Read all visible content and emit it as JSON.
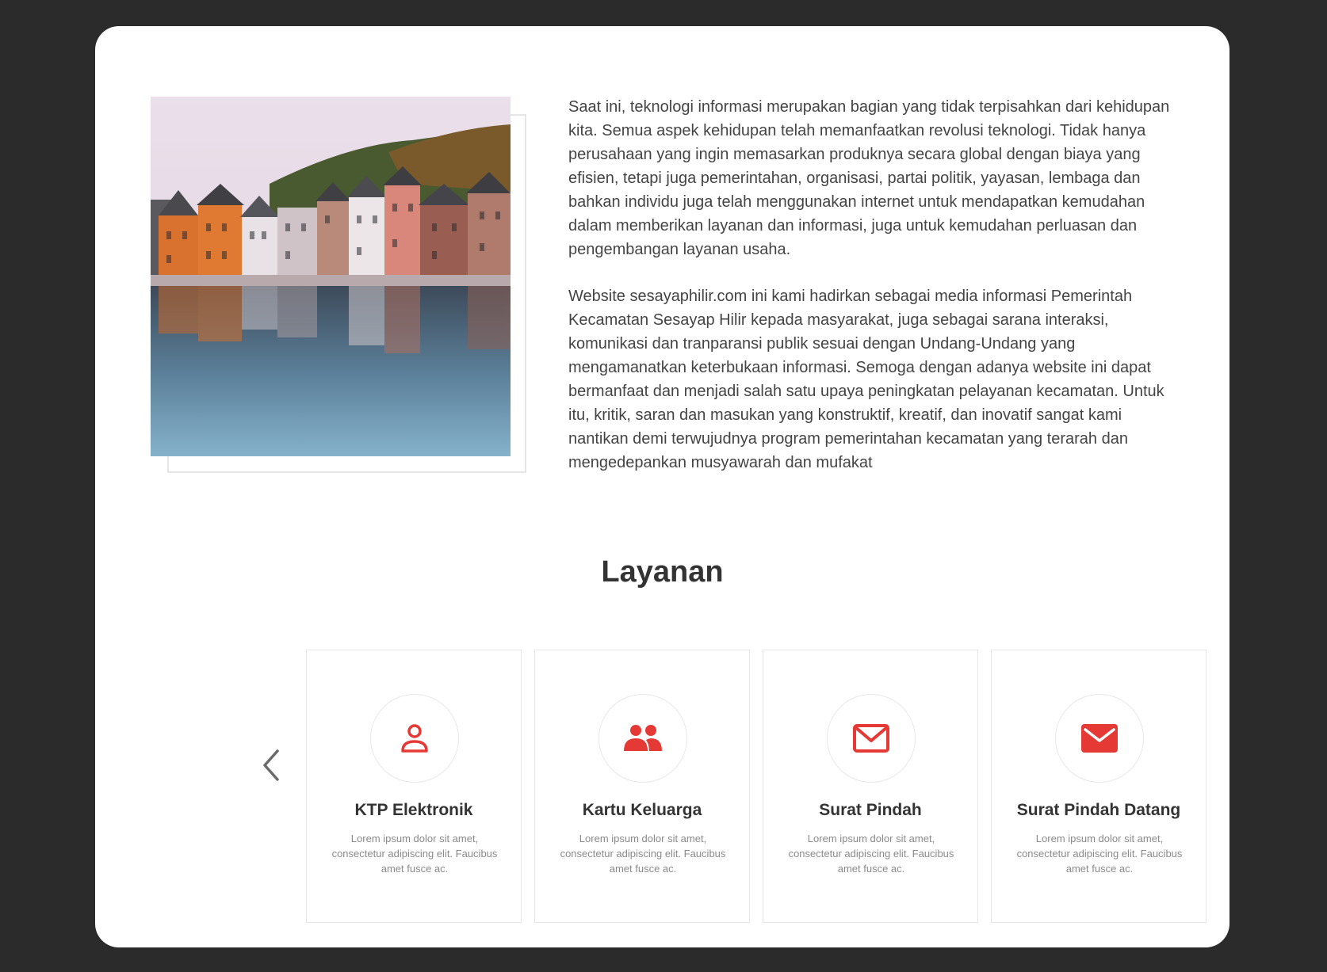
{
  "about": {
    "image_alt": "riverside-town-photo",
    "paragraphs": [
      "Saat ini, teknologi informasi merupakan bagian yang tidak terpisahkan dari kehidupan kita. Semua aspek kehidupan telah memanfaatkan revolusi teknologi. Tidak hanya perusahaan yang ingin memasarkan produknya secara global dengan biaya yang efisien, tetapi juga pemerintahan, organisasi, partai politik, yayasan, lembaga dan bahkan individu juga telah menggunakan internet untuk mendapatkan kemudahan dalam memberikan layanan dan informasi, juga untuk kemudahan perluasan dan pengembangan layanan usaha.",
      "Website sesayaphilir.com ini kami hadirkan sebagai media informasi Pemerintah Kecamatan Sesayap Hilir kepada masyarakat, juga sebagai sarana interaksi, komunikasi dan tranparansi publik sesuai dengan Undang-Undang yang mengamanatkan keterbukaan informasi. Semoga dengan adanya website ini dapat bermanfaat dan menjadi salah satu upaya peningkatan pelayanan kecamatan. Untuk itu, kritik, saran dan masukan yang konstruktif, kreatif, dan inovatif sangat kami nantikan demi terwujudnya program pemerintahan kecamatan yang terarah dan mengedepankan musyawarah dan mufakat"
    ]
  },
  "services": {
    "title": "Layanan",
    "prev_icon": "chevron-left-icon",
    "next_icon": "chevron-right-icon",
    "accent_color": "#e53935",
    "items": [
      {
        "title": "KTP Elektronik",
        "icon": "user-icon",
        "description": "Lorem ipsum dolor sit amet, consectetur adipiscing elit. Faucibus amet fusce ac."
      },
      {
        "title": "Kartu Keluarga",
        "icon": "users-icon",
        "description": "Lorem ipsum dolor sit amet, consectetur adipiscing elit. Faucibus amet fusce ac."
      },
      {
        "title": "Surat Pindah",
        "icon": "mail-outline-icon",
        "description": "Lorem ipsum dolor sit amet, consectetur adipiscing elit. Faucibus amet fusce ac."
      },
      {
        "title": "Surat Pindah Datang",
        "icon": "mail-filled-icon",
        "description": "Lorem ipsum dolor sit amet, consectetur adipiscing elit. Faucibus amet fusce ac."
      }
    ]
  }
}
